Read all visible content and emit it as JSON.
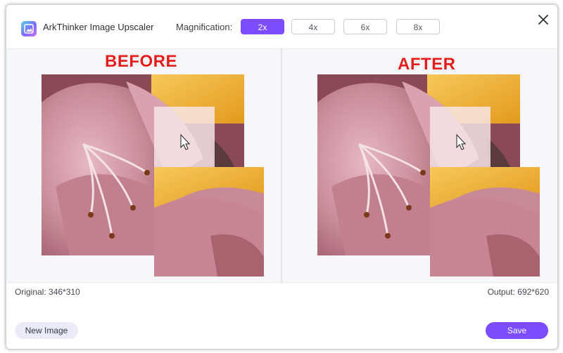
{
  "app": {
    "title": "ArkThinker Image Upscaler",
    "icon": "image-icon"
  },
  "magnification": {
    "label": "Magnification:",
    "options": [
      "2x",
      "4x",
      "6x",
      "8x"
    ],
    "selected": "2x"
  },
  "compare": {
    "before_label": "BEFORE",
    "after_label": "AFTER"
  },
  "info": {
    "original": "Original: 346*310",
    "output": "Output: 692*620"
  },
  "footer": {
    "new_image_label": "New Image",
    "save_label": "Save"
  },
  "colors": {
    "accent": "#7b4dff",
    "stamp": "#e31c1c",
    "petal": "#c98a98",
    "petal_light": "#e8c2c8",
    "yellow": "#f1b537"
  }
}
